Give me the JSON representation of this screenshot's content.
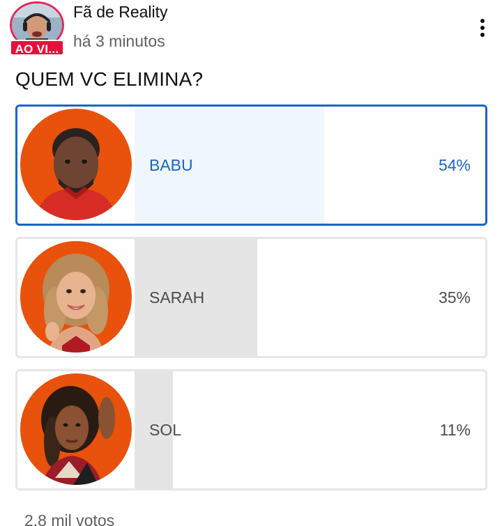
{
  "header": {
    "channel_name": "Fã de Reality",
    "time_ago": "há 3 minutos",
    "live_badge": "AO VI...",
    "menu_icon": "more-vert-icon"
  },
  "poll": {
    "question": "QUEM VC ELIMINA?",
    "options": [
      {
        "label": "BABU",
        "percent": "54%",
        "fraction": 0.54,
        "selected": true
      },
      {
        "label": "SARAH",
        "percent": "35%",
        "fraction": 0.35,
        "selected": false
      },
      {
        "label": "SOL",
        "percent": "11%",
        "fraction": 0.11,
        "selected": false
      }
    ],
    "votes": "2,8 mil votos"
  },
  "colors": {
    "accent_blue": "#1a64c8",
    "selected_fill": "#eff6fe",
    "unselected_fill": "#e5e5e5",
    "live_red": "#e4123a",
    "photo_background": "#e8520c"
  }
}
